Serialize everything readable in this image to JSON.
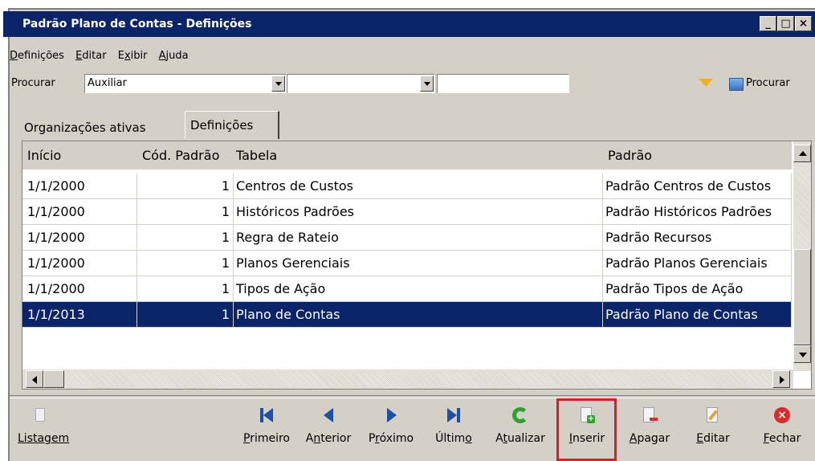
{
  "window": {
    "title": "Padrão Plano de Contas -  Definições"
  },
  "menu": [
    {
      "label": "Definições"
    },
    {
      "label": "Editar"
    },
    {
      "label": "Exibir"
    },
    {
      "label": "Ajuda"
    }
  ],
  "search": {
    "label": "Procurar",
    "field1_value": "Auxiliar",
    "field2_value": "",
    "field3_value": "",
    "button_label": "Procurar"
  },
  "tabs": [
    {
      "label": "Organizações ativas",
      "active": false
    },
    {
      "label": "Definições",
      "active": true
    }
  ],
  "table": {
    "columns": [
      "Início",
      "Cód. Padrão",
      "Tabela",
      "Padrão"
    ],
    "rows": [
      {
        "inicio": "1/1/2000",
        "cod": "1",
        "tabela": "Centros de Custos",
        "padrao": "Padrão Centros de Custos"
      },
      {
        "inicio": "1/1/2000",
        "cod": "1",
        "tabela": "Históricos Padrões",
        "padrao": "Padrão Históricos Padrões"
      },
      {
        "inicio": "1/1/2000",
        "cod": "1",
        "tabela": "Regra de Rateio",
        "padrao": "Padrão Recursos"
      },
      {
        "inicio": "1/1/2000",
        "cod": "1",
        "tabela": "Planos Gerenciais",
        "padrao": "Padrão Planos Gerenciais"
      },
      {
        "inicio": "1/1/2000",
        "cod": "1",
        "tabela": "Tipos de Ação",
        "padrao": "Padrão Tipos de Ação"
      },
      {
        "inicio": "1/1/2013",
        "cod": "1",
        "tabela": "Plano de Contas",
        "padrao": "Padrão Plano de Contas",
        "selected": true
      }
    ]
  },
  "toolbar": {
    "listagem": "Listagem",
    "primeiro": "Primeiro",
    "anterior": "Anterior",
    "proximo": "Próximo",
    "ultimo": "Último",
    "atualizar": "Atualizar",
    "inserir": "Inserir",
    "apagar": "Apagar",
    "editar": "Editar",
    "fechar": "Fechar"
  },
  "colors": {
    "title_bar": "#0a246a",
    "selection": "#0a246a",
    "nav_icon": "#1c4fa8",
    "refresh_icon": "#2aa52a",
    "close_icon": "#d92b2b",
    "highlight_box": "#e01b24"
  }
}
